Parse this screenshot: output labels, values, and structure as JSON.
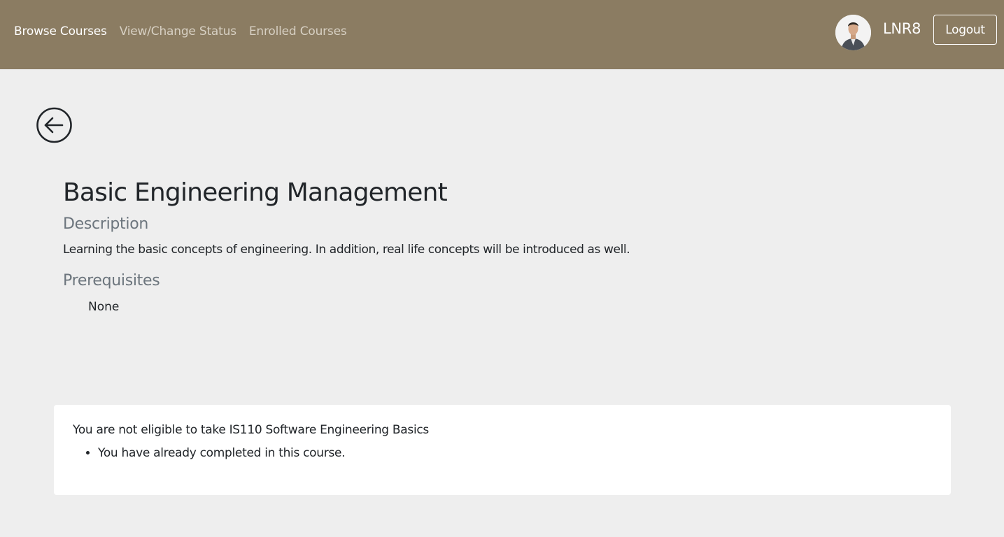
{
  "navbar": {
    "links": [
      {
        "label": "Browse Courses"
      },
      {
        "label": "View/Change Status"
      },
      {
        "label": "Enrolled Courses"
      }
    ],
    "username": "LNR8",
    "logout_label": "Logout",
    "background_color": "#8b7c62"
  },
  "icons": {
    "back": "arrow-left-circle-icon",
    "avatar": "user-avatar"
  },
  "course": {
    "title": "Basic Engineering Management",
    "description_heading": "Description",
    "description": "Learning the basic concepts of engineering. In addition, real life concepts will be introduced as well.",
    "prerequisites_heading": "Prerequisites",
    "prerequisites": [
      "None"
    ]
  },
  "alert": {
    "message": "You are not eligible to take IS110 Software Engineering Basics",
    "reasons": [
      "You have already completed in this course."
    ]
  }
}
